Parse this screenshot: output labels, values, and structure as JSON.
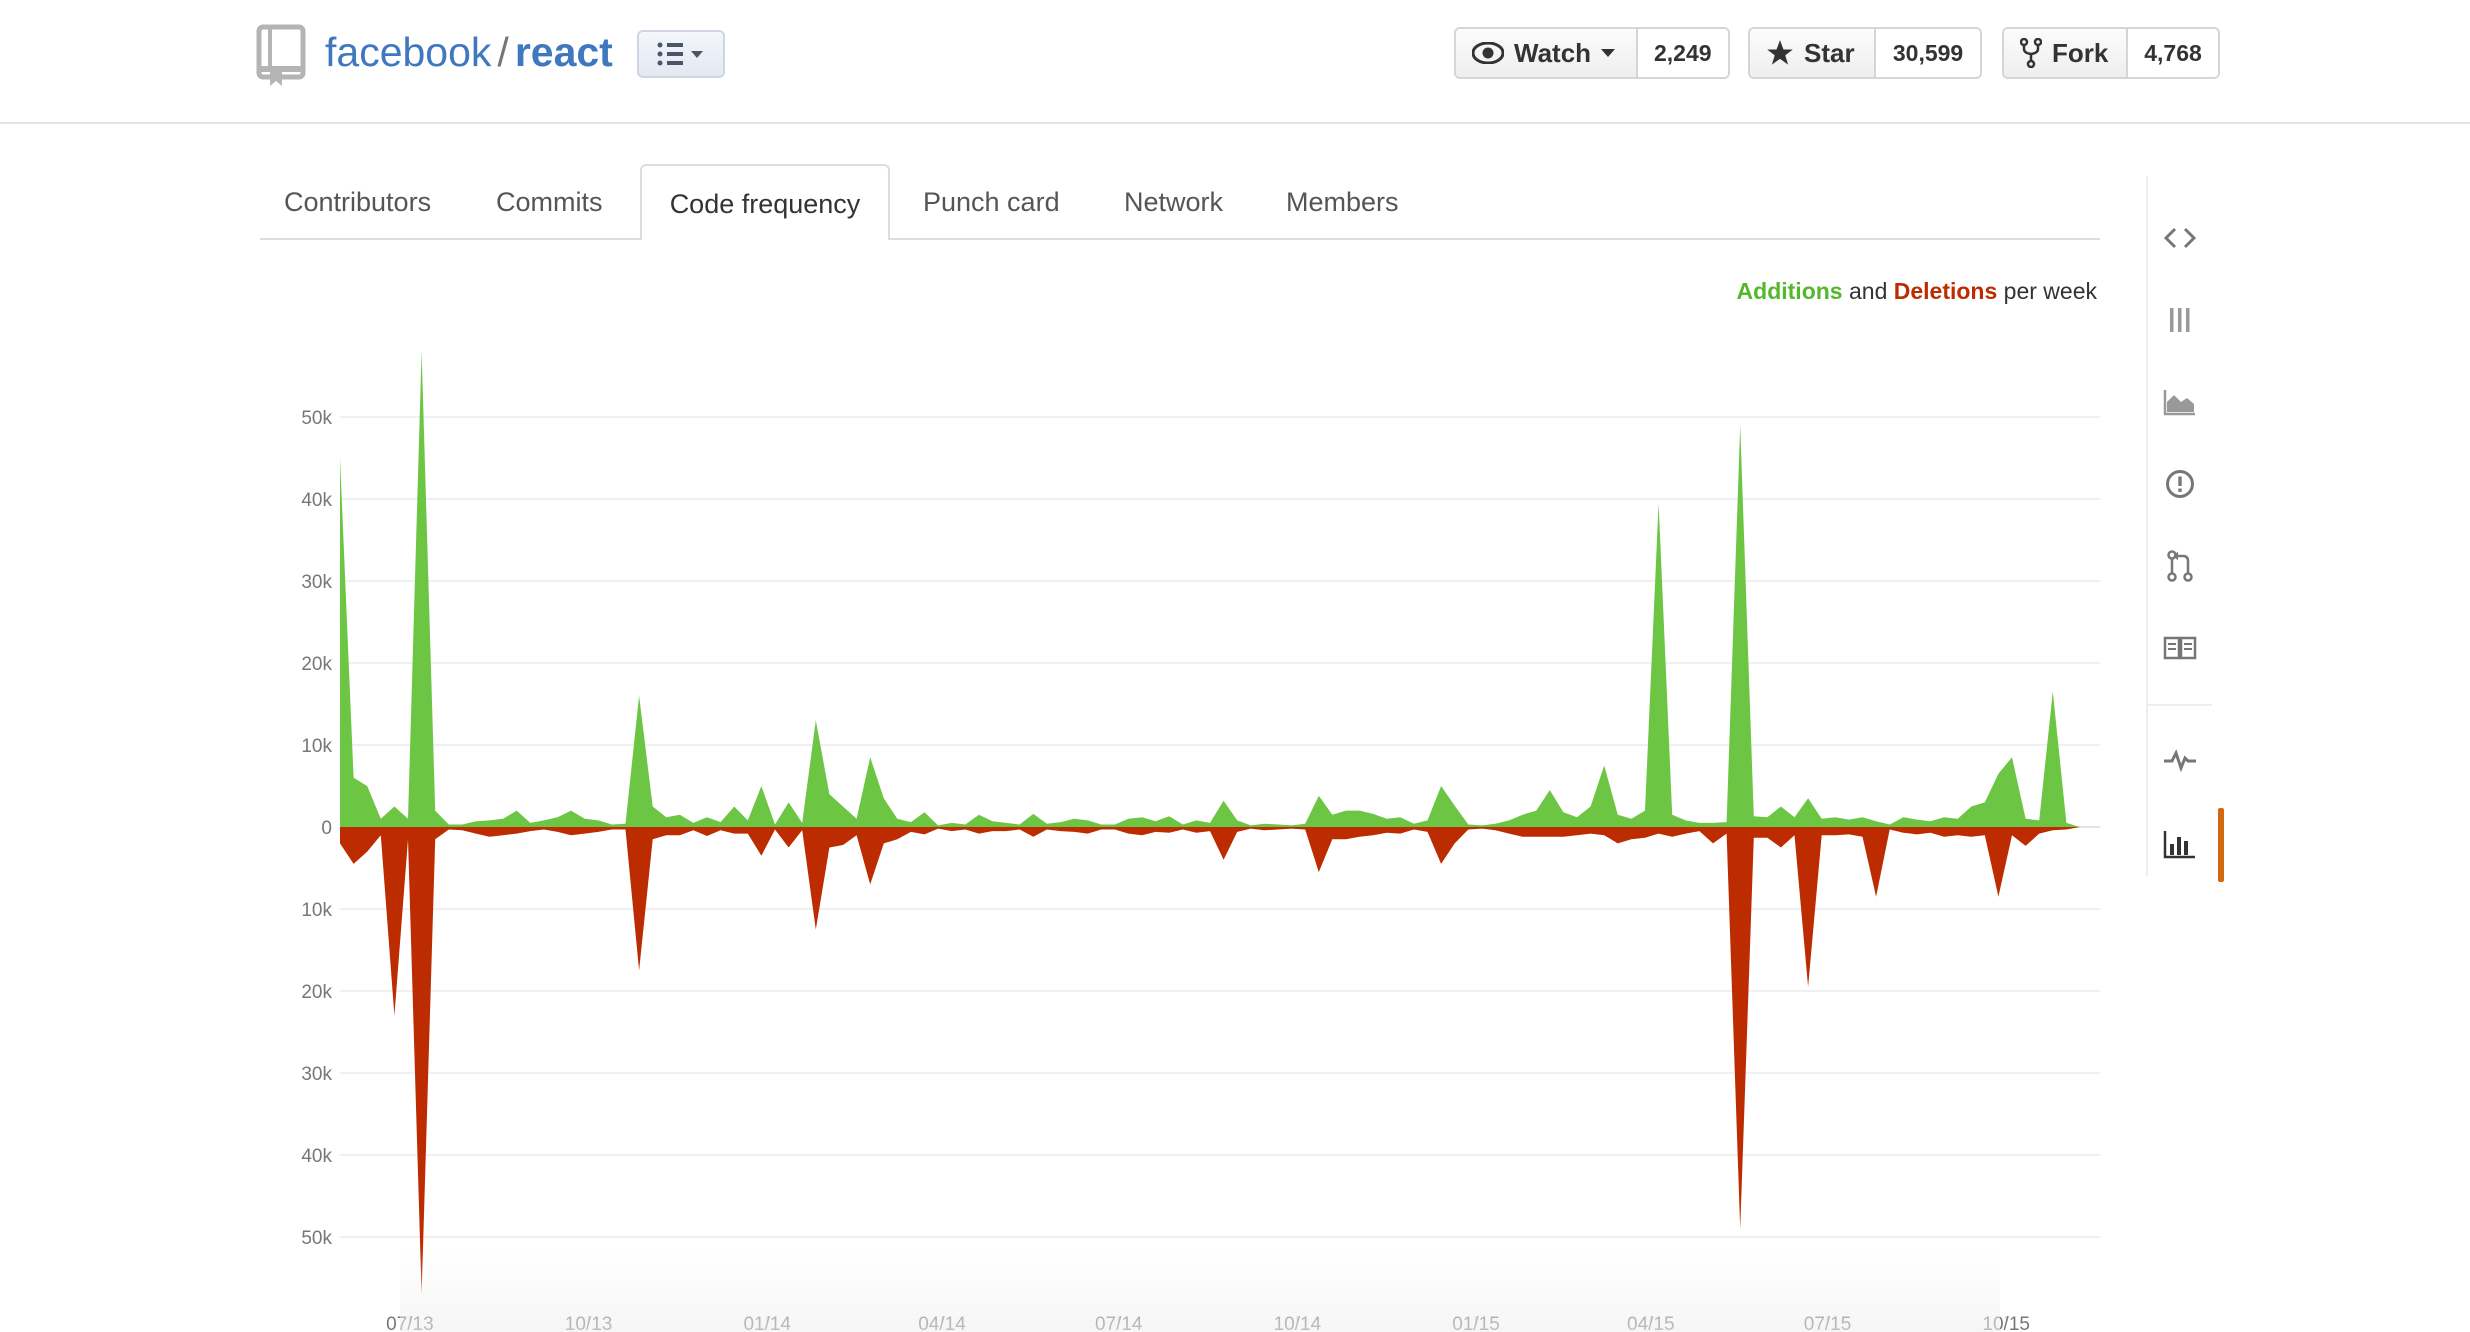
{
  "repo": {
    "owner": "facebook",
    "separator": "/",
    "name": "react"
  },
  "actions": {
    "watch": {
      "label": "Watch",
      "count": "2,249"
    },
    "star": {
      "label": "Star",
      "count": "30,599"
    },
    "fork": {
      "label": "Fork",
      "count": "4,768"
    }
  },
  "tabs": [
    {
      "label": "Contributors",
      "active": false
    },
    {
      "label": "Commits",
      "active": false
    },
    {
      "label": "Code frequency",
      "active": true
    },
    {
      "label": "Punch card",
      "active": false
    },
    {
      "label": "Network",
      "active": false
    },
    {
      "label": "Members",
      "active": false
    }
  ],
  "legend": {
    "additions": "Additions",
    "and": "and",
    "deletions": "Deletions",
    "per_week": "per week"
  },
  "colors": {
    "additions": "#6cc644",
    "deletions": "#bd2c00",
    "accent": "#4078c0",
    "active_side": "#d26911"
  },
  "sidebar_icons": [
    "code-icon",
    "issues-list-icon",
    "graph-area-icon",
    "issue-opened-icon",
    "pull-request-icon",
    "wiki-book-icon",
    "pulse-icon",
    "graph-bars-icon"
  ],
  "chart_data": {
    "type": "area",
    "title": "",
    "xlabel": "",
    "ylabel": "",
    "ylim": [
      -55000,
      55000
    ],
    "yticks": [
      50000,
      40000,
      30000,
      20000,
      10000,
      0,
      -10000,
      -20000,
      -30000,
      -40000,
      -50000
    ],
    "ytick_labels": [
      "50k",
      "40k",
      "30k",
      "20k",
      "10k",
      "0",
      "10k",
      "20k",
      "30k",
      "40k",
      "50k"
    ],
    "xticks": [
      "07/13",
      "10/13",
      "01/14",
      "04/14",
      "07/14",
      "10/14",
      "01/15",
      "04/15",
      "07/15",
      "10/15"
    ],
    "grid": true,
    "legend_position": "top-right",
    "x": [
      "2013-05-26",
      "2013-06-02",
      "2013-06-09",
      "2013-06-16",
      "2013-06-23",
      "2013-06-30",
      "2013-07-07",
      "2013-07-14",
      "2013-07-21",
      "2013-07-28",
      "2013-08-04",
      "2013-08-11",
      "2013-08-18",
      "2013-08-25",
      "2013-09-01",
      "2013-09-08",
      "2013-09-15",
      "2013-09-22",
      "2013-09-29",
      "2013-10-06",
      "2013-10-13",
      "2013-10-20",
      "2013-10-27",
      "2013-11-03",
      "2013-11-10",
      "2013-11-17",
      "2013-11-24",
      "2013-12-01",
      "2013-12-08",
      "2013-12-15",
      "2013-12-22",
      "2013-12-29",
      "2014-01-05",
      "2014-01-12",
      "2014-01-19",
      "2014-01-26",
      "2014-02-02",
      "2014-02-09",
      "2014-02-16",
      "2014-02-23",
      "2014-03-02",
      "2014-03-09",
      "2014-03-16",
      "2014-03-23",
      "2014-03-30",
      "2014-04-06",
      "2014-04-13",
      "2014-04-20",
      "2014-04-27",
      "2014-05-04",
      "2014-05-11",
      "2014-05-18",
      "2014-05-25",
      "2014-06-01",
      "2014-06-08",
      "2014-06-15",
      "2014-06-22",
      "2014-06-29",
      "2014-07-06",
      "2014-07-13",
      "2014-07-20",
      "2014-07-27",
      "2014-08-03",
      "2014-08-10",
      "2014-08-17",
      "2014-08-24",
      "2014-08-31",
      "2014-09-07",
      "2014-09-14",
      "2014-09-21",
      "2014-09-28",
      "2014-10-05",
      "2014-10-12",
      "2014-10-19",
      "2014-10-26",
      "2014-11-02",
      "2014-11-09",
      "2014-11-16",
      "2014-11-23",
      "2014-11-30",
      "2014-12-07",
      "2014-12-14",
      "2014-12-21",
      "2014-12-28",
      "2015-01-04",
      "2015-01-11",
      "2015-01-18",
      "2015-01-25",
      "2015-02-01",
      "2015-02-08",
      "2015-02-15",
      "2015-02-22",
      "2015-03-01",
      "2015-03-08",
      "2015-03-15",
      "2015-03-22",
      "2015-03-29",
      "2015-04-05",
      "2015-04-12",
      "2015-04-19",
      "2015-04-26",
      "2015-05-03",
      "2015-05-10",
      "2015-05-17",
      "2015-05-24",
      "2015-05-31",
      "2015-06-07",
      "2015-06-14",
      "2015-06-21",
      "2015-06-28",
      "2015-07-05",
      "2015-07-12",
      "2015-07-19",
      "2015-07-26",
      "2015-08-02",
      "2015-08-09",
      "2015-08-16",
      "2015-08-23",
      "2015-08-30",
      "2015-09-06",
      "2015-09-13",
      "2015-09-20",
      "2015-09-27",
      "2015-10-04",
      "2015-10-11",
      "2015-10-18",
      "2015-10-25",
      "2015-11-01",
      "2015-11-08"
    ],
    "series": [
      {
        "name": "Additions",
        "values": [
          45000,
          6000,
          5000,
          1000,
          2500,
          1000,
          58000,
          2000,
          300,
          300,
          700,
          800,
          1000,
          2000,
          500,
          800,
          1200,
          2000,
          1000,
          800,
          300,
          400,
          16000,
          2500,
          1200,
          1500,
          500,
          1200,
          600,
          2500,
          800,
          5000,
          300,
          3000,
          500,
          13000,
          4000,
          2500,
          1000,
          8500,
          3500,
          1000,
          600,
          1800,
          200,
          500,
          300,
          1500,
          700,
          500,
          300,
          1600,
          400,
          600,
          1000,
          800,
          300,
          300,
          1000,
          1200,
          700,
          1300,
          300,
          800,
          500,
          3200,
          800,
          200,
          400,
          300,
          200,
          400,
          3800,
          1500,
          2000,
          2000,
          1600,
          1000,
          1200,
          400,
          800,
          5000,
          2600,
          300,
          200,
          400,
          800,
          1500,
          2000,
          4500,
          1800,
          1200,
          2500,
          7500,
          1500,
          1000,
          2000,
          39500,
          1500,
          800,
          500,
          500,
          600,
          49000,
          1300,
          1200,
          2500,
          1200,
          3500,
          1000,
          1200,
          900,
          1200,
          700,
          300,
          1200,
          900,
          700,
          1200,
          1000,
          2500,
          3000,
          6500,
          8500,
          1000,
          800,
          16500,
          500
        ]
      },
      {
        "name": "Deletions",
        "values": [
          -2000,
          -4500,
          -3000,
          -1000,
          -23000,
          -1500,
          -57000,
          -1500,
          -300,
          -400,
          -800,
          -1200,
          -1000,
          -800,
          -500,
          -300,
          -600,
          -1000,
          -800,
          -600,
          -300,
          -300,
          -17500,
          -1500,
          -1000,
          -1000,
          -400,
          -1100,
          -400,
          -800,
          -800,
          -3500,
          -300,
          -2500,
          -400,
          -12500,
          -2500,
          -2200,
          -1000,
          -7000,
          -2000,
          -1500,
          -600,
          -900,
          -200,
          -500,
          -300,
          -800,
          -500,
          -500,
          -300,
          -1200,
          -300,
          -500,
          -600,
          -800,
          -300,
          -300,
          -800,
          -1000,
          -600,
          -700,
          -300,
          -700,
          -500,
          -4000,
          -600,
          -200,
          -400,
          -300,
          -200,
          -300,
          -5500,
          -1500,
          -1500,
          -1200,
          -1000,
          -700,
          -800,
          -300,
          -600,
          -4500,
          -2000,
          -300,
          -200,
          -400,
          -800,
          -1200,
          -1200,
          -1200,
          -1200,
          -1000,
          -800,
          -1000,
          -2000,
          -1500,
          -1300,
          -800,
          -1200,
          -800,
          -500,
          -2000,
          -800,
          -49000,
          -1300,
          -1300,
          -2500,
          -1000,
          -19500,
          -1000,
          -1000,
          -900,
          -1200,
          -8500,
          -300,
          -700,
          -900,
          -700,
          -1200,
          -1000,
          -1200,
          -1000,
          -8500,
          -1000,
          -2300,
          -800,
          -400,
          -300
        ]
      }
    ]
  }
}
